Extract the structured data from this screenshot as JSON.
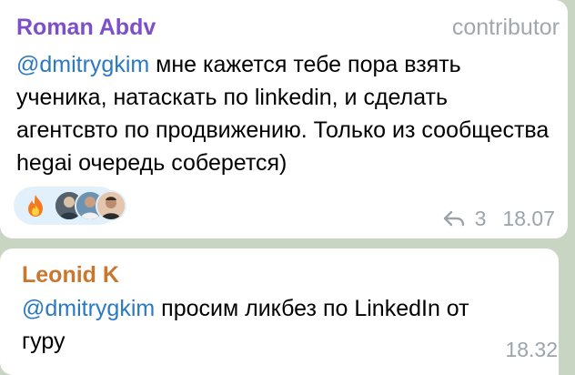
{
  "messages": [
    {
      "author": "Roman Abdv",
      "author_color": "#7d4fc8",
      "role": "contributor",
      "mention": "@dmitrygkim",
      "text_line1": " мне кажется тебе пора взять",
      "text_rest": "ученика, натаскать по linkedin, и сделать агентсвто по продвижению. Только из сообщества hegai очередь соберется)",
      "reaction_emoji": "fire-emoji",
      "reaction_avatars": 3,
      "reply_count": "3",
      "time": "18.07"
    },
    {
      "author": "Leonid K",
      "author_color": "#c8772e",
      "mention": "@dmitrygkim",
      "text_line1": " просим ликбез по LinkedIn от",
      "text_rest": "гуру",
      "time": "18.32"
    }
  ],
  "icons": {
    "reply": "reply-arrow-icon",
    "reaction": "fire-icon"
  }
}
